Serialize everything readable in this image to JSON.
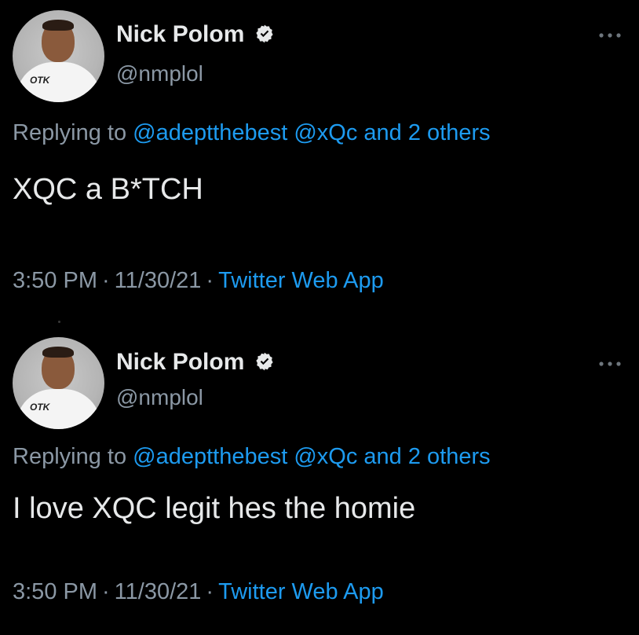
{
  "tweets": [
    {
      "author": {
        "name": "Nick Polom",
        "handle": "@nmplol",
        "avatar_shirt_text": "OTK"
      },
      "reply": {
        "prefix": "Replying to",
        "mention_1": "@adeptthebest",
        "mention_2": "@xQc",
        "and_text": "and",
        "others": "2 others"
      },
      "text": "XQC a B*TCH",
      "time": "3:50 PM",
      "date": "11/30/21",
      "source": "Twitter Web App",
      "separator": "·"
    },
    {
      "author": {
        "name": "Nick Polom",
        "handle": "@nmplol",
        "avatar_shirt_text": "OTK"
      },
      "reply": {
        "prefix": "Replying to",
        "mention_1": "@adeptthebest",
        "mention_2": "@xQc",
        "and_text": "and",
        "others": "2 others"
      },
      "text": "I love XQC legit hes the homie",
      "time": "3:50 PM",
      "date": "11/30/21",
      "source": "Twitter Web App",
      "separator": "·"
    }
  ],
  "icons": {
    "verified": "verified-badge-icon",
    "more": "more-options-icon"
  },
  "colors": {
    "background": "#000000",
    "primary_text": "#e7e9ea",
    "secondary_text": "#8b98a5",
    "link": "#1d9bf0"
  }
}
